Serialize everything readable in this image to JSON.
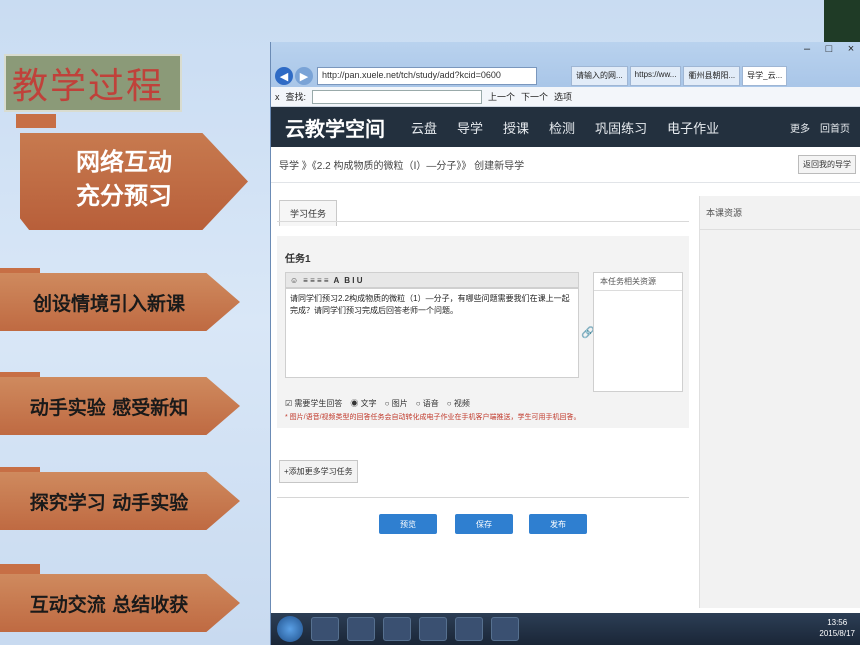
{
  "slide": {
    "title": "教学过程",
    "nav_main": {
      "line1": "网络互动",
      "line2": "充分预习"
    },
    "nav_items": [
      "创设情境引入新课",
      "动手实验 感受新知",
      "探究学习 动手实验",
      "互动交流 总结收获"
    ]
  },
  "browser": {
    "address": "http://pan.xuele.net/tch/study/add?kcid=0600",
    "tabs": [
      "请输入的网...",
      "https://ww...",
      "衢州县朝阳...",
      "导学_云..."
    ],
    "find_label": "查找:",
    "find_prev": "上一个",
    "find_next": "下一个",
    "find_options": "选项"
  },
  "site": {
    "logo": "云教学空间",
    "nav": [
      "云盘",
      "导学",
      "授课",
      "检测",
      "巩固练习",
      "电子作业"
    ],
    "nav_right": [
      "更多",
      "回首页"
    ],
    "breadcrumb": "导学 》《2.2 构成物质的微粒（Ⅰ）—分子》》 创建新导学",
    "back_button": "返回我的导学",
    "side_panel_title": "本课资源"
  },
  "task": {
    "tab_label": "学习任务",
    "title": "任务1",
    "toolbar": "B  I  U",
    "editor_text": "请同学们预习2.2构成物质的微粒（1）—分子，有哪些问题需要我们在课上一起完成？请同学们预习完成后回答老师一个问题。",
    "resources_title": "本任务相关资源",
    "options": [
      "需要学生回答",
      "文字",
      "图片",
      "语音",
      "视频"
    ],
    "note": "* 图片/语音/视频类型的回答任务会自动转化成电子作业在手机客户端推送，学生可用手机回答。",
    "add_more": "+添加更多学习任务",
    "buttons": [
      "预览",
      "保存",
      "发布"
    ]
  },
  "taskbar": {
    "time": "13:56",
    "date": "2015/8/17"
  }
}
